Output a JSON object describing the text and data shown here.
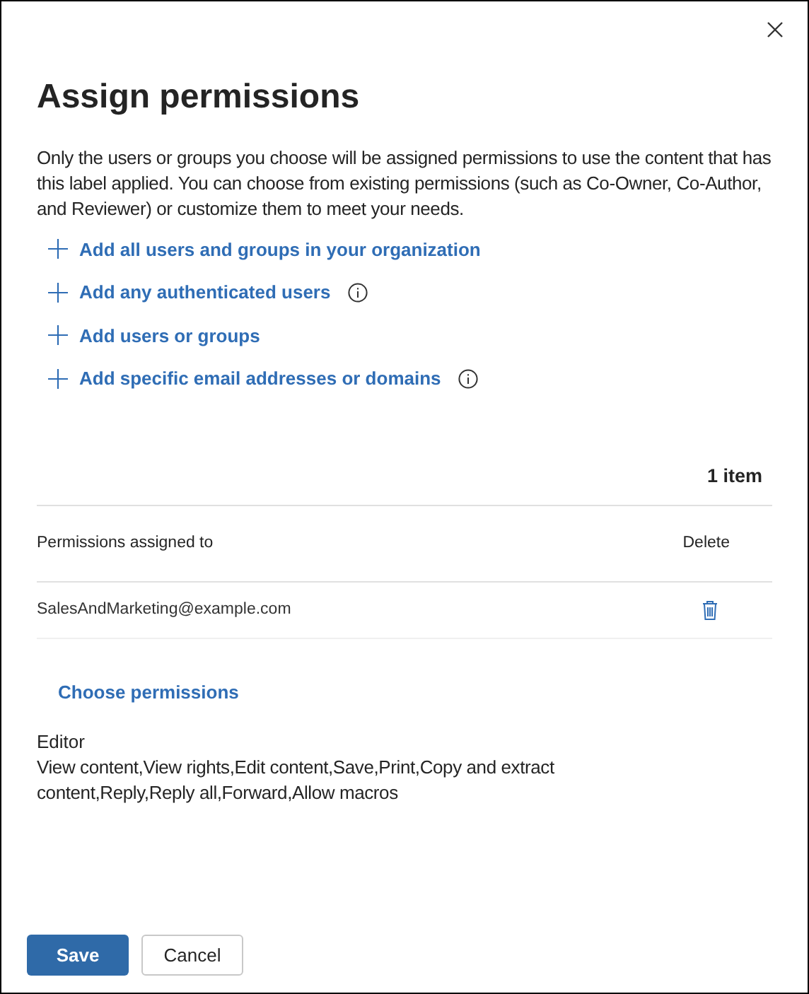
{
  "title": "Assign permissions",
  "description": "Only the users or groups you choose will be assigned permissions to use the content that has this label applied. You can choose from existing permissions (such as Co-Owner, Co-Author, and Reviewer) or customize them to meet your needs.",
  "add_actions": [
    {
      "label": "Add all users and groups in your organization",
      "info": false
    },
    {
      "label": "Add any authenticated users",
      "info": true
    },
    {
      "label": "Add users or groups",
      "info": false
    },
    {
      "label": "Add specific email addresses or domains",
      "info": true
    }
  ],
  "item_count": "1 item",
  "table": {
    "columns": [
      "Permissions assigned to",
      "Delete"
    ],
    "rows": [
      {
        "assigned_to": "SalesAndMarketing@example.com"
      }
    ]
  },
  "choose_permissions": "Choose permissions",
  "permission_level": "Editor",
  "permission_rights": "View content,View rights,Edit content,Save,Print,Copy and extract content,Reply,Reply all,Forward,Allow macros",
  "buttons": [
    {
      "label": "Save",
      "kind": "primary"
    },
    {
      "label": "Cancel",
      "kind": "secondary"
    }
  ]
}
